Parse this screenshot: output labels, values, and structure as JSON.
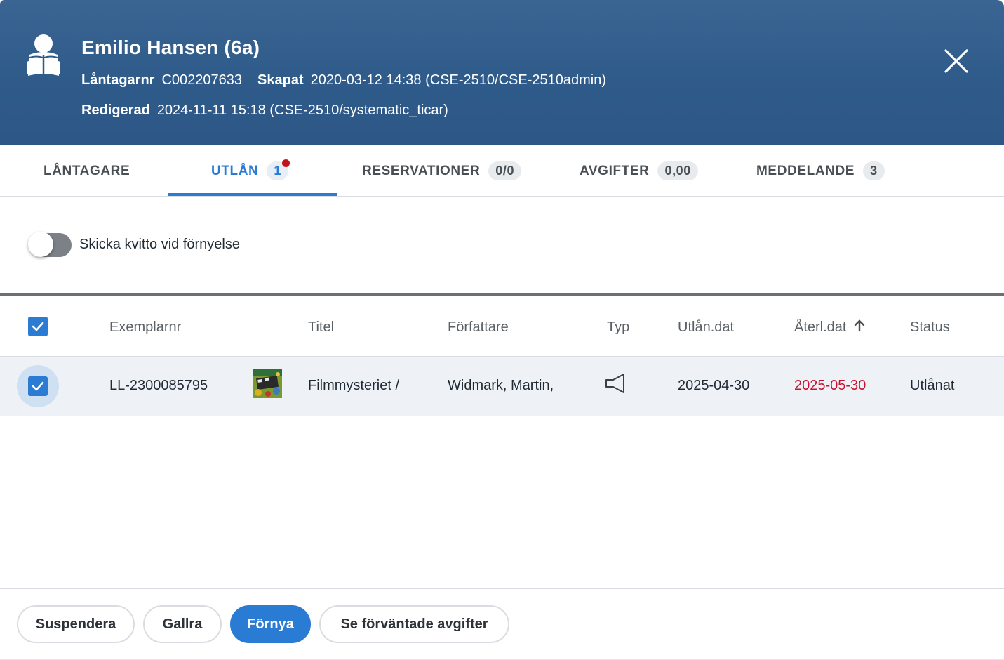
{
  "header": {
    "name": "Emilio Hansen (6a)",
    "borrower_label": "Låntagarnr",
    "borrower_value": "C002207633",
    "created_label": "Skapat",
    "created_value": "2020-03-12 14:38 (CSE-2510/CSE-2510admin)",
    "edited_label": "Redigerad",
    "edited_value": "2024-11-11 15:18 (CSE-2510/systematic_ticar)",
    "avatar_icon": "reading-person-icon",
    "close_icon": "close-icon"
  },
  "tabs": [
    {
      "label": "LÅNTAGARE",
      "badge": ""
    },
    {
      "label": "UTLÅN",
      "badge": "1",
      "active": true,
      "notification": true
    },
    {
      "label": "RESERVATIONER",
      "badge": "0/0"
    },
    {
      "label": "AVGIFTER",
      "badge": "0,00"
    },
    {
      "label": "MEDDELANDE",
      "badge": "3"
    }
  ],
  "toggle": {
    "label": "Skicka kvitto vid förnyelse",
    "on": false
  },
  "table": {
    "columns": [
      "Exemplarnr",
      "Titel",
      "Författare",
      "Typ",
      "Utlån.dat",
      "Återl.dat",
      "Status"
    ],
    "sort_column": "Återl.dat",
    "sort_direction": "ascending",
    "select_all_checked": true,
    "rows": [
      {
        "checked": true,
        "item_number": "LL-2300085795",
        "title": "Filmmysteriet /",
        "author": "Widmark, Martin,",
        "type_icon": "audiobook-speaker-icon",
        "loan_date": "2025-04-30",
        "due_date": "2025-05-30",
        "status": "Utlånat"
      }
    ]
  },
  "actions": {
    "suspend": "Suspendera",
    "weed": "Gallra",
    "renew": "Förnya",
    "expected_fees": "Se förväntade avgifter"
  },
  "colors": {
    "header_bg": "#2f5b8a",
    "accent": "#2a7bd4",
    "overdue": "#c8102e",
    "notification_dot": "#c4121b"
  }
}
